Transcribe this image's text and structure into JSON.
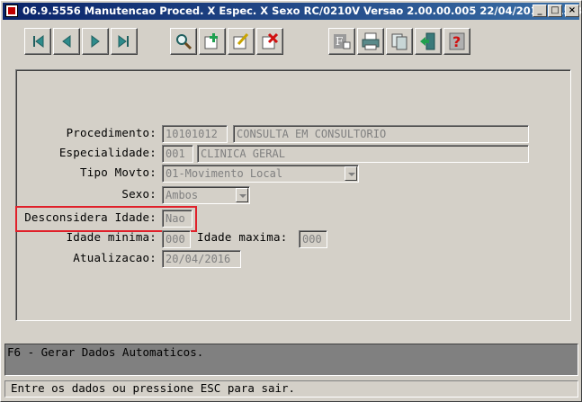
{
  "window": {
    "title": "06.9.5556 Manutencao  Proced. X Espec. X Sexo RC/0210V Versao 2.00.00.005 22/04/2016 - 15:34",
    "minimize": "_",
    "maximize": "□",
    "close": "×"
  },
  "toolbar": {
    "buttons": [
      {
        "name": "first-record",
        "icon": "first-icon"
      },
      {
        "name": "previous-record",
        "icon": "previous-icon"
      },
      {
        "name": "next-record",
        "icon": "next-icon"
      },
      {
        "name": "last-record",
        "icon": "last-icon"
      },
      {
        "name": "search",
        "icon": "zoom-icon"
      },
      {
        "name": "add",
        "icon": "add-icon"
      },
      {
        "name": "edit",
        "icon": "edit-icon"
      },
      {
        "name": "delete",
        "icon": "delete-icon"
      },
      {
        "name": "filter",
        "icon": "filter-icon"
      },
      {
        "name": "print",
        "icon": "printer-icon"
      },
      {
        "name": "copy",
        "icon": "copy-icon"
      },
      {
        "name": "exit",
        "icon": "exit-icon"
      },
      {
        "name": "help",
        "icon": "help-icon"
      }
    ]
  },
  "form": {
    "procedimento": {
      "label": "Procedimento:",
      "code": "10101012",
      "description": "CONSULTA EM CONSULTORIO"
    },
    "especialidade": {
      "label": "Especialidade:",
      "code": "001",
      "description": "CLINICA GERAL"
    },
    "tipo_movto": {
      "label": "Tipo Movto:",
      "value": "01-Movimento Local"
    },
    "sexo": {
      "label": "Sexo:",
      "value": "Ambos"
    },
    "desconsidera_idade": {
      "label": "Desconsidera Idade:",
      "value": "Nao"
    },
    "idade_minima": {
      "label": "Idade minima:",
      "value": "000"
    },
    "idade_maxima": {
      "label": "Idade maxima:",
      "value": "000"
    },
    "atualizacao": {
      "label": "Atualizacao:",
      "value": "20/04/2016"
    }
  },
  "messages": {
    "hint": "F6 - Gerar Dados Automaticos.",
    "status": "Entre os dados ou pressione ESC para sair."
  },
  "colors": {
    "title_bar": "#0a246a",
    "highlight_box": "#e0202a",
    "window_bg": "#d4d0c8"
  }
}
